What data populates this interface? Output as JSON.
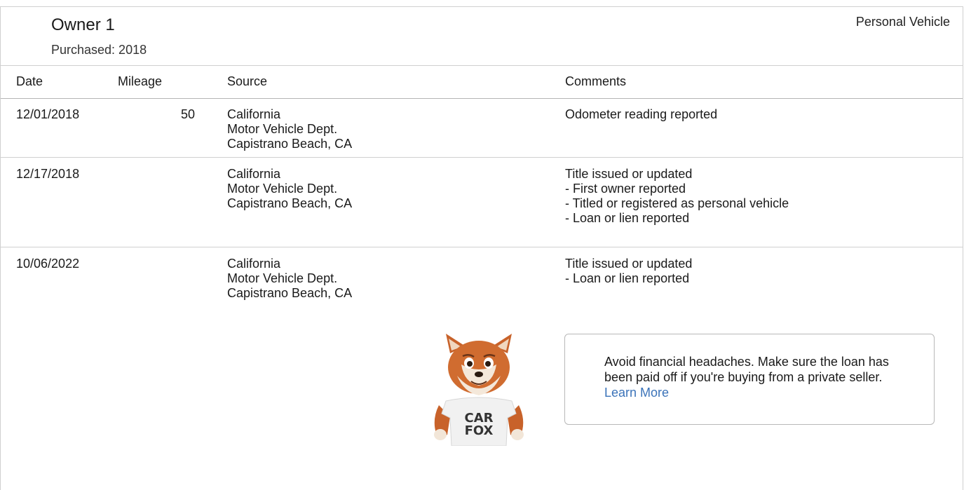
{
  "owner": {
    "title": "Owner 1",
    "purchased": "Purchased: 2018",
    "vehicle_type": "Personal Vehicle"
  },
  "table": {
    "headers": {
      "date": "Date",
      "mileage": "Mileage",
      "source": "Source",
      "comments": "Comments"
    },
    "rows": [
      {
        "date": "12/01/2018",
        "mileage": "50",
        "source": [
          "California",
          "Motor Vehicle Dept.",
          "Capistrano Beach, CA"
        ],
        "comment_head": "Odometer reading reported",
        "comment_lines": []
      },
      {
        "date": "12/17/2018",
        "mileage": "",
        "source": [
          "California",
          "Motor Vehicle Dept.",
          "Capistrano Beach, CA"
        ],
        "comment_head": "Title issued or updated",
        "comment_lines": [
          "- First owner reported",
          "- Titled or registered as personal vehicle",
          "- Loan or lien reported"
        ]
      },
      {
        "date": "10/06/2022",
        "mileage": "",
        "source": [
          "California",
          "Motor Vehicle Dept.",
          "Capistrano Beach, CA"
        ],
        "comment_head": "Title issued or updated",
        "comment_lines": [
          "- Loan or lien reported"
        ]
      }
    ]
  },
  "tip": {
    "text": "Avoid financial headaches. Make sure the loan has been paid off if you're buying from a private seller.",
    "link": "Learn More"
  },
  "mascot": {
    "shirt_line1": "CAR",
    "shirt_line2": "FOX"
  },
  "colors": {
    "link": "#3b73b9",
    "border": "#d0d0d0"
  }
}
